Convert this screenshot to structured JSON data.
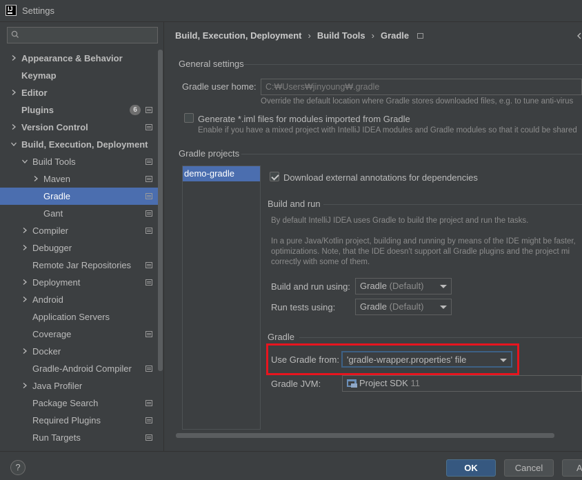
{
  "window": {
    "title": "Settings"
  },
  "search": {
    "placeholder": ""
  },
  "sidebar": {
    "items": [
      {
        "label": "Appearance & Behavior"
      },
      {
        "label": "Keymap"
      },
      {
        "label": "Editor"
      },
      {
        "label": "Plugins",
        "badge": "6"
      },
      {
        "label": "Version Control"
      },
      {
        "label": "Build, Execution, Deployment"
      },
      {
        "label": "Build Tools"
      },
      {
        "label": "Maven"
      },
      {
        "label": "Gradle"
      },
      {
        "label": "Gant"
      },
      {
        "label": "Compiler"
      },
      {
        "label": "Debugger"
      },
      {
        "label": "Remote Jar Repositories"
      },
      {
        "label": "Deployment"
      },
      {
        "label": "Android"
      },
      {
        "label": "Application Servers"
      },
      {
        "label": "Coverage"
      },
      {
        "label": "Docker"
      },
      {
        "label": "Gradle-Android Compiler"
      },
      {
        "label": "Java Profiler"
      },
      {
        "label": "Package Search"
      },
      {
        "label": "Required Plugins"
      },
      {
        "label": "Run Targets"
      }
    ]
  },
  "breadcrumb": {
    "items": [
      "Build, Execution, Deployment",
      "Build Tools",
      "Gradle"
    ],
    "separator": "›"
  },
  "general": {
    "title": "General settings",
    "gradle_home_label": "Gradle user home:",
    "gradle_home_value": "C:₩Users₩jinyoung₩.gradle",
    "gradle_home_hint": "Override the default location where Gradle stores downloaded files, e.g. to tune anti-virus",
    "iml_label": "Generate *.iml files for modules imported from Gradle",
    "iml_hint": "Enable if you have a mixed project with IntelliJ IDEA modules and Gradle modules so that it could be shared"
  },
  "projects": {
    "title": "Gradle projects",
    "list": [
      "demo-gradle"
    ],
    "annotations_label": "Download external annotations for dependencies"
  },
  "build_run": {
    "title": "Build and run",
    "hint1": "By default IntelliJ IDEA uses Gradle to build the project and run the tasks.",
    "hint2_line1": "In a pure Java/Kotlin project, building and running by means of the IDE might be faster,",
    "hint2_line2": "optimizations. Note, that the IDE doesn't support all Gradle plugins and the project mi",
    "hint2_line3": "correctly with some of them.",
    "build_label": "Build and run using:",
    "build_value": "Gradle",
    "build_value_suffix": "(Default)",
    "tests_label": "Run tests using:",
    "tests_value": "Gradle",
    "tests_value_suffix": "(Default)"
  },
  "gradle": {
    "title": "Gradle",
    "use_from_label": "Use Gradle from:",
    "use_from_value": "'gradle-wrapper.properties' file",
    "jvm_label": "Gradle JVM:",
    "jvm_value": "Project SDK",
    "jvm_version": "11"
  },
  "buttons": {
    "help": "?",
    "ok": "OK",
    "cancel": "Cancel",
    "apply": "A"
  },
  "colors": {
    "selection": "#4b6eaf",
    "highlight_box": "#e8141e",
    "primary_button": "#365880"
  }
}
